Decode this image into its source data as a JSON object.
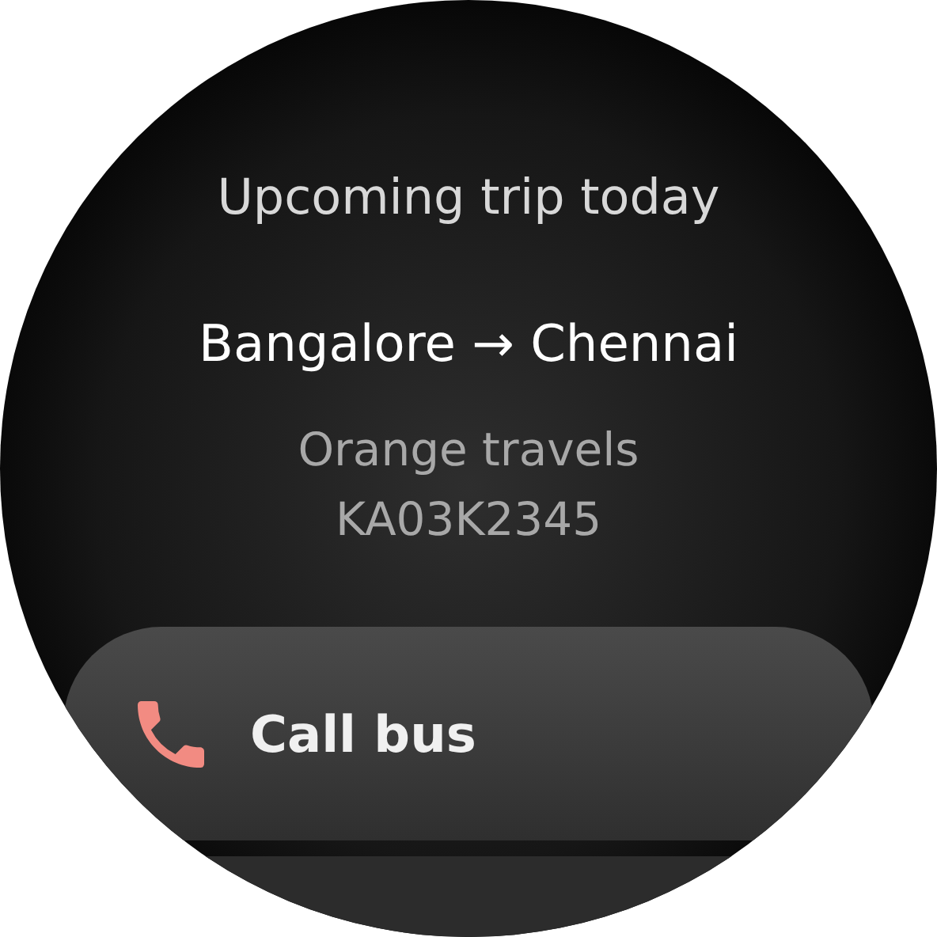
{
  "title": "Upcoming trip today",
  "route": "Bangalore → Chennai",
  "operator": "Orange travels",
  "vehicle_number": "KA03K2345",
  "action_chip": {
    "label": "Call bus"
  }
}
